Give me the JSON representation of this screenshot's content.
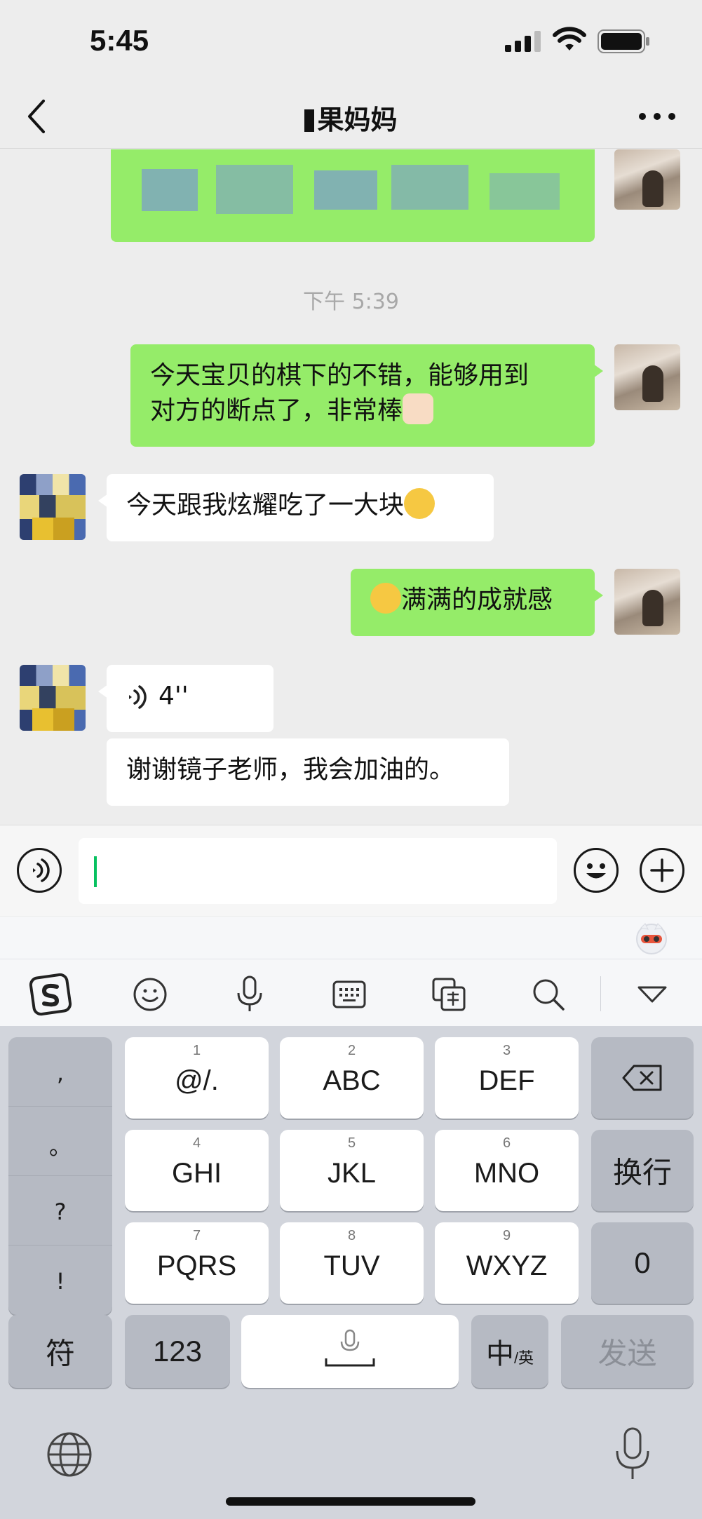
{
  "status_bar": {
    "time": "5:45"
  },
  "nav": {
    "title": "果妈妈"
  },
  "messages": [
    {
      "type": "blurred",
      "side": "self"
    },
    {
      "type": "timestamp",
      "text": "下午 5:39"
    },
    {
      "type": "text",
      "side": "self",
      "text_line1": "今天宝贝的棋下的不错，能够用到",
      "text_line2": "对方的断点了，非常棒",
      "emoji": "thumbs-up"
    },
    {
      "type": "text",
      "side": "other",
      "text": "今天跟我炫耀吃了一大块",
      "emoji": "smirk"
    },
    {
      "type": "text",
      "side": "self",
      "text": "满满的成就感",
      "emoji": "grin"
    },
    {
      "type": "voice",
      "side": "other",
      "duration": "4''"
    },
    {
      "type": "text",
      "side": "other",
      "text": "谢谢镜子老师，我会加油的。"
    }
  ],
  "input": {
    "value": ""
  },
  "keyboard": {
    "punct": [
      ",",
      "。",
      "?",
      "!"
    ],
    "rows": [
      [
        {
          "num": "1",
          "label": "@/."
        },
        {
          "num": "2",
          "label": "ABC"
        },
        {
          "num": "3",
          "label": "DEF"
        }
      ],
      [
        {
          "num": "4",
          "label": "GHI"
        },
        {
          "num": "5",
          "label": "JKL"
        },
        {
          "num": "6",
          "label": "MNO"
        }
      ],
      [
        {
          "num": "7",
          "label": "PQRS"
        },
        {
          "num": "8",
          "label": "TUV"
        },
        {
          "num": "9",
          "label": "WXYZ"
        }
      ]
    ],
    "newline": "换行",
    "zero": "0",
    "symbols": "符",
    "numbers": "123",
    "lang_main": "中",
    "lang_sub": "/英",
    "send": "发送"
  },
  "colors": {
    "self_bubble": "#95ec69",
    "other_bubble": "#ffffff",
    "accent": "#07c160"
  }
}
